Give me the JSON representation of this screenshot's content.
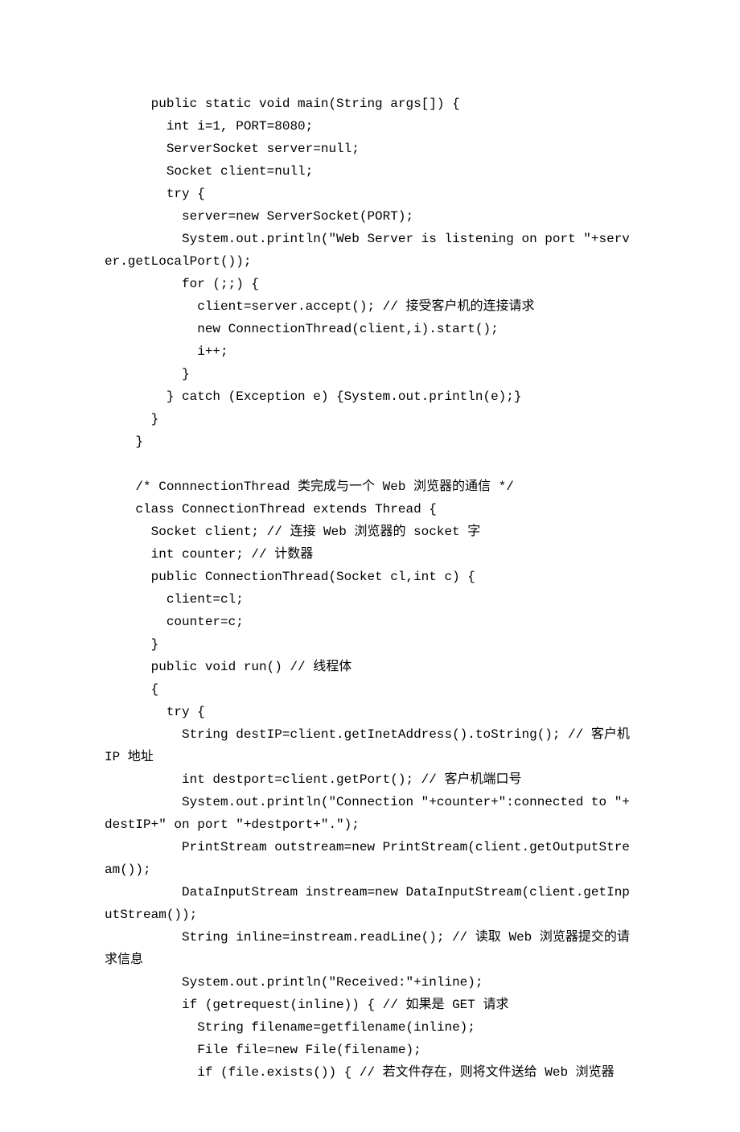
{
  "code_lines": [
    "      public static void main(String args[]) {",
    "        int i=1, PORT=8080;",
    "        ServerSocket server=null;",
    "        Socket client=null;",
    "        try {",
    "          server=new ServerSocket(PORT);",
    "          System.out.println(\"Web Server is listening on port \"+server.getLocalPort());",
    "          for (;;) {",
    "            client=server.accept(); // 接受客户机的连接请求",
    "            new ConnectionThread(client,i).start();",
    "            i++;",
    "          }",
    "        } catch (Exception e) {System.out.println(e);}",
    "      }",
    "    }",
    "",
    "    /* ConnnectionThread 类完成与一个 Web 浏览器的通信 */",
    "    class ConnectionThread extends Thread {",
    "      Socket client; // 连接 Web 浏览器的 socket 字",
    "      int counter; // 计数器",
    "      public ConnectionThread(Socket cl,int c) {",
    "        client=cl;",
    "        counter=c;",
    "      }",
    "      public void run() // 线程体",
    "      {",
    "        try {",
    "          String destIP=client.getInetAddress().toString(); // 客户机IP 地址",
    "          int destport=client.getPort(); // 客户机端口号",
    "          System.out.println(\"Connection \"+counter+\":connected to \"+destIP+\" on port \"+destport+\".\");",
    "          PrintStream outstream=new PrintStream(client.getOutputStream());",
    "          DataInputStream instream=new DataInputStream(client.getInputStream());",
    "          String inline=instream.readLine(); // 读取 Web 浏览器提交的请求信息",
    "          System.out.println(\"Received:\"+inline);",
    "          if (getrequest(inline)) { // 如果是 GET 请求",
    "            String filename=getfilename(inline);",
    "            File file=new File(filename);",
    "            if (file.exists()) { // 若文件存在，则将文件送给 Web 浏览器"
  ]
}
